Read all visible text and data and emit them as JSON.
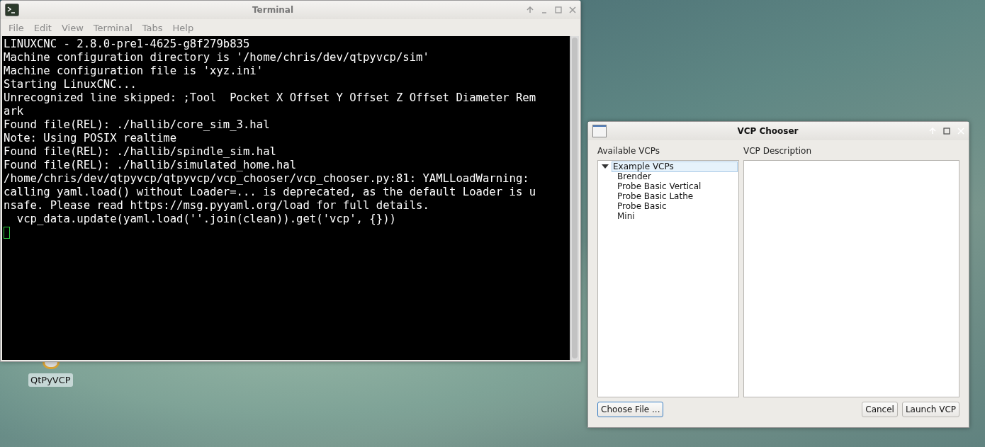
{
  "terminal_window": {
    "title": "Terminal",
    "menu": [
      {
        "label": "File"
      },
      {
        "label": "Edit"
      },
      {
        "label": "View"
      },
      {
        "label": "Terminal"
      },
      {
        "label": "Tabs"
      },
      {
        "label": "Help"
      }
    ],
    "lines": [
      "LINUXCNC - 2.8.0-pre1-4625-g8f279b835",
      "Machine configuration directory is '/home/chris/dev/qtpyvcp/sim'",
      "Machine configuration file is 'xyz.ini'",
      "Starting LinuxCNC...",
      "Unrecognized line skipped: ;Tool  Pocket X Offset Y Offset Z Offset Diameter Rem",
      "ark",
      "Found file(REL): ./hallib/core_sim_3.hal",
      "Note: Using POSIX realtime",
      "Found file(REL): ./hallib/spindle_sim.hal",
      "Found file(REL): ./hallib/simulated_home.hal",
      "/home/chris/dev/qtpyvcp/qtpyvcp/vcp_chooser/vcp_chooser.py:81: YAMLLoadWarning:",
      "calling yaml.load() without Loader=... is deprecated, as the default Loader is u",
      "nsafe. Please read https://msg.pyyaml.org/load for full details.",
      "  vcp_data.update(yaml.load(''.join(clean)).get('vcp', {}))"
    ]
  },
  "desktop_icon": {
    "label": "QtPyVCP"
  },
  "chooser_window": {
    "title": "VCP Chooser",
    "list_label": "Available VCPs",
    "description_label": "VCP Description",
    "tree": [
      {
        "label": "Example VCPs",
        "expanded": true,
        "selected": true,
        "children": [
          {
            "label": "Brender",
            "selected": false
          },
          {
            "label": "Probe Basic Vertical",
            "selected": false
          },
          {
            "label": "Probe Basic Lathe",
            "selected": false
          },
          {
            "label": "Probe Basic",
            "selected": false
          },
          {
            "label": "Mini",
            "selected": false
          }
        ]
      }
    ],
    "buttons": [
      {
        "label": "Choose File ...",
        "focused": true
      },
      {
        "label": "Cancel",
        "focused": false
      },
      {
        "label": "Launch VCP",
        "focused": false
      }
    ]
  }
}
